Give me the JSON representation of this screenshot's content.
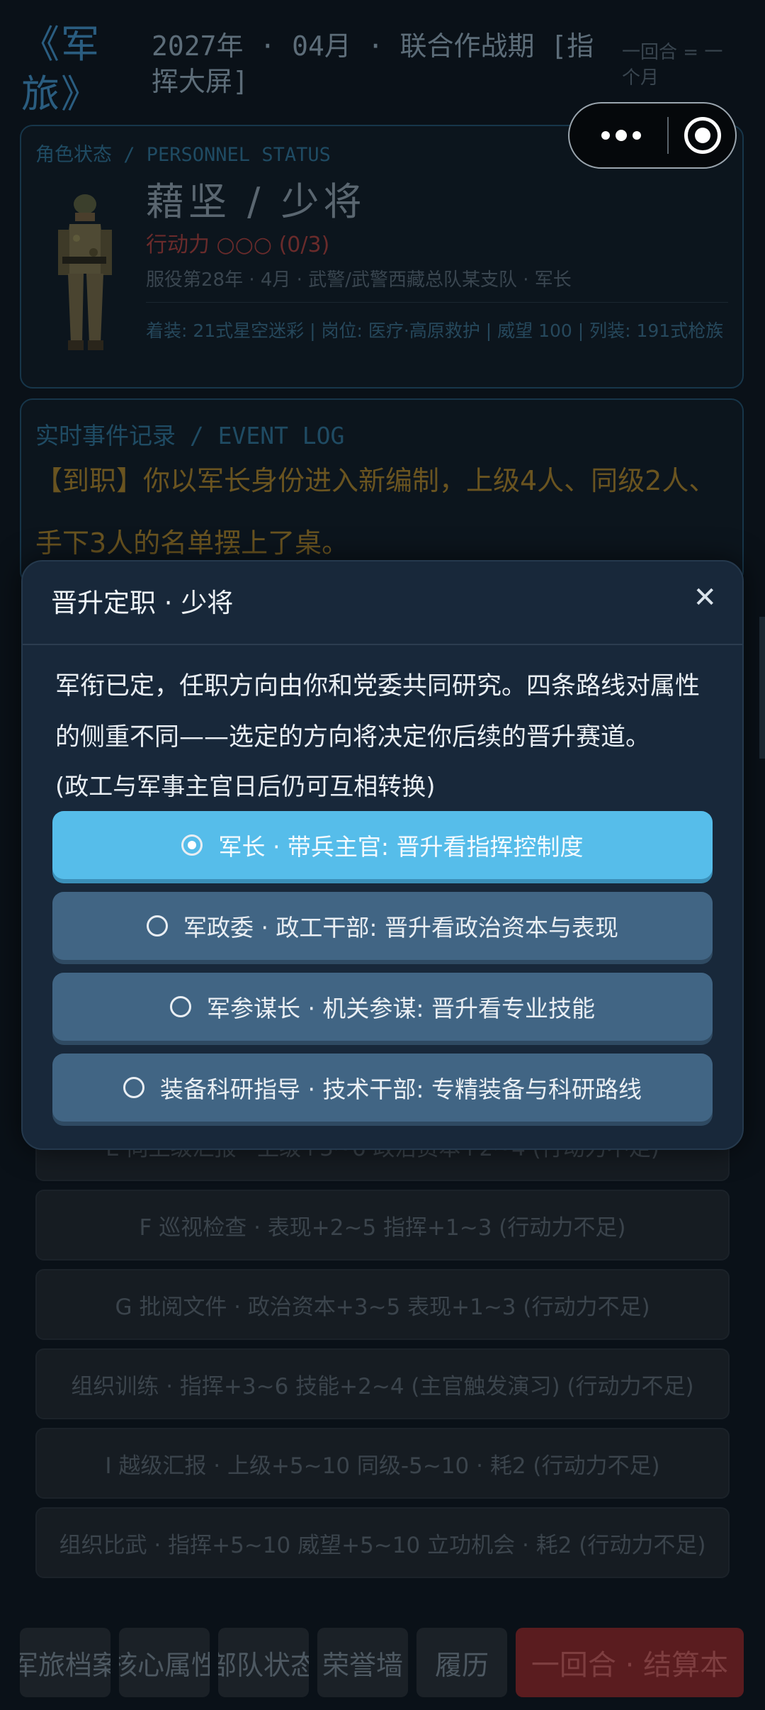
{
  "header": {
    "brand": "《军旅》",
    "date_line": "2027年 · 04月 · 联合作战期 [指挥大屏]",
    "turn_hint": "一回合 = 一个月"
  },
  "status_card": {
    "title": "角色状态 / PERSONNEL STATUS",
    "name": "藉坚 / 少将",
    "action_points": "行动力 ○○○ (0/3)",
    "service": "服役第28年 · 4月 · 武警/武警西藏总队某支队 · 军长",
    "gear": "着装: 21式星空迷彩 | 岗位: 医疗·高原救护 | 威望 100 | 列装: 191式枪族"
  },
  "event_log": {
    "title": "实时事件记录 / EVENT LOG",
    "text": "【到职】你以军长身份进入新编制，上级4人、同级2人、手下3人的名单摆上了桌。"
  },
  "actions": [
    {
      "label": "E 向上级汇报 · 上级+3~6 政治资本+2~4 (行动力不足)"
    },
    {
      "label": "F 巡视检查 · 表现+2~5 指挥+1~3 (行动力不足)"
    },
    {
      "label": "G 批阅文件 · 政治资本+3~5 表现+1~3 (行动力不足)"
    },
    {
      "label": "组织训练 · 指挥+3~6 技能+2~4 (主官触发演习) (行动力不足)"
    },
    {
      "label": "I 越级汇报 · 上级+5~10 同级-5~10 · 耗2 (行动力不足)"
    },
    {
      "label": "组织比武 · 指挥+5~10 威望+5~10 立功机会 · 耗2 (行动力不足)"
    }
  ],
  "bottom_nav": {
    "items": [
      "军旅档案",
      "核心属性",
      "部队状态",
      "荣誉墙",
      "履历"
    ],
    "end_turn": "一回合 · 结算本"
  },
  "modal": {
    "title": "晋升定职 · 少将",
    "close": "✕",
    "body": "军衔已定，任职方向由你和党委共同研究。四条路线对属性的侧重不同——选定的方向将决定你后续的晋升赛道。",
    "note": "(政工与军事主官日后仍可互相转换)",
    "options": [
      {
        "label": "军长 · 带兵主官: 晋升看指挥控制度",
        "selected": true
      },
      {
        "label": "军政委 · 政工干部: 晋升看政治资本与表现",
        "selected": false
      },
      {
        "label": "军参谋长 · 机关参谋: 晋升看专业技能",
        "selected": false
      },
      {
        "label": "装备科研指导 · 技术干部: 专精装备与科研路线",
        "selected": false
      }
    ]
  },
  "colors": {
    "background": "#0a1118",
    "modal": "#18283a",
    "option_selected": "#56bdea",
    "option": "#416584",
    "end_turn": "#5a1c1f"
  },
  "icons": {
    "more": "more-dots-icon",
    "target": "target-icon",
    "close": "close-icon",
    "radio": "radio-icon"
  }
}
